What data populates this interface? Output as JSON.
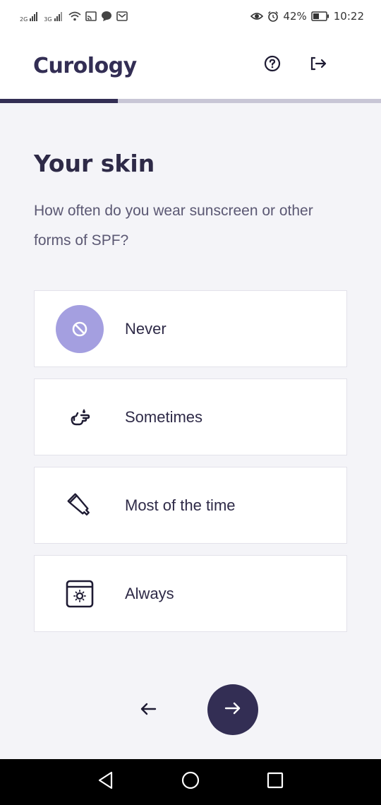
{
  "status_bar": {
    "network_1": "2G",
    "network_2": "3G",
    "battery": "42%",
    "time": "10:22"
  },
  "header": {
    "logo": "Curology",
    "help_icon": "question-circle-icon",
    "logout_icon": "logout-arrow-icon"
  },
  "progress": {
    "fraction": 0.31
  },
  "page": {
    "title": "Your skin",
    "question": "How often do you wear sunscreen or other forms of SPF?"
  },
  "options": [
    {
      "label": "Never",
      "icon": "no-symbol-icon",
      "selected": true
    },
    {
      "label": "Sometimes",
      "icon": "hand-drop-icon",
      "selected": false
    },
    {
      "label": "Most of the time",
      "icon": "tube-icon",
      "selected": false
    },
    {
      "label": "Always",
      "icon": "sun-window-icon",
      "selected": false
    }
  ],
  "nav": {
    "back_icon": "arrow-left-icon",
    "next_icon": "arrow-right-icon"
  },
  "colors": {
    "brand": "#332e54",
    "selected_icon_bg": "#a49fe0",
    "background": "#f4f4f8"
  }
}
